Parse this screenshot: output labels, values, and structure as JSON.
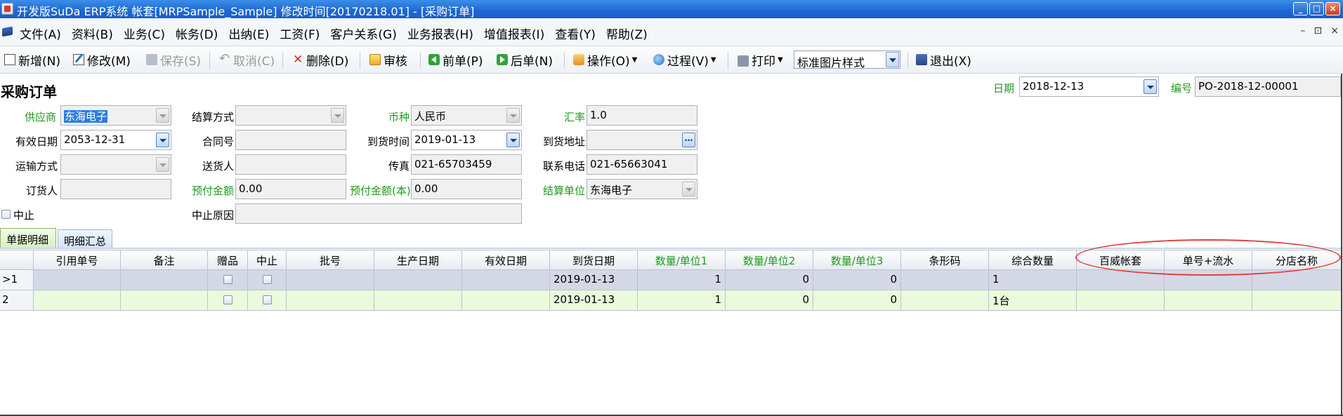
{
  "window": {
    "title": "开发版SuDa ERP系统  帐套[MRPSample_Sample] 修改时间[20170218.01] - [采购订单]",
    "controls": [
      "_",
      "□",
      "×"
    ]
  },
  "menu": {
    "items": [
      "文件(A)",
      "资料(B)",
      "业务(C)",
      "帐务(D)",
      "出纳(E)",
      "工资(F)",
      "客户关系(G)",
      "业务报表(H)",
      "增值报表(I)",
      "查看(Y)",
      "帮助(Z)"
    ],
    "mdi_controls": [
      "–",
      "⊡",
      "×"
    ]
  },
  "toolbar": {
    "new": "新增(N)",
    "edit": "修改(M)",
    "save": "保存(S)",
    "cancel": "取消(C)",
    "delete": "删除(D)",
    "audit": "审核",
    "prev": "前单(P)",
    "next": "后单(N)",
    "operation": "操作(O)",
    "process": "过程(V)",
    "print": "打印",
    "print_style": "标准图片样式",
    "exit": "退出(X)"
  },
  "form": {
    "title": "采购订单",
    "date_label": "日期",
    "date": "2018-12-13",
    "number_label": "编号",
    "number": "PO-2018-12-00001",
    "supplier_label": "供应商",
    "supplier": "东海电子",
    "settle_method_label": "结算方式",
    "settle_method": "",
    "currency_label": "币种",
    "currency": "人民币",
    "rate_label": "汇率",
    "rate": "1.0",
    "valid_date_label": "有效日期",
    "valid_date": "2053-12-31",
    "contract_label": "合同号",
    "contract": "",
    "arrival_time_label": "到货时间",
    "arrival_time": "2019-01-13",
    "arrival_addr_label": "到货地址",
    "arrival_addr": "",
    "transport_label": "运输方式",
    "transport": "",
    "deliverer_label": "送货人",
    "deliverer": "",
    "fax_label": "传真",
    "fax": "021-65703459",
    "phone_label": "联系电话",
    "phone": "021-65663041",
    "orderer_label": "订货人",
    "orderer": "",
    "prepay_label": "预付金额",
    "prepay": "0.00",
    "prepay_base_label": "预付金额(本)",
    "prepay_base": "0.00",
    "settle_unit_label": "结算单位",
    "settle_unit": "东海电子",
    "stop_label": "中止",
    "stop_reason_label": "中止原因",
    "stop_reason": ""
  },
  "tabs": [
    "单据明细",
    "明细汇总"
  ],
  "grid": {
    "columns": [
      "引用单号",
      "备注",
      "赠品",
      "中止",
      "批号",
      "生产日期",
      "有效日期",
      "到货日期",
      "数量/单位1",
      "数量/单位2",
      "数量/单位3",
      "条形码",
      "综合数量",
      "百威帐套",
      "单号+流水",
      "分店名称"
    ],
    "rows": [
      {
        "marker": ">1",
        "cells": [
          "",
          "",
          "",
          "",
          "",
          "",
          "",
          "2019-01-13",
          "1",
          "0",
          "0",
          "",
          "1",
          "",
          "",
          ""
        ]
      },
      {
        "marker": "2",
        "cells": [
          "",
          "",
          "",
          "",
          "",
          "",
          "",
          "2019-01-13",
          "1",
          "0",
          "0",
          "",
          "1台",
          "",
          "",
          ""
        ]
      }
    ]
  },
  "colors": {
    "titlebar": "#1d68d3",
    "green_label": "#1e9a1e",
    "row_selected": "#d5d8e6",
    "row_alt": "#eafadd",
    "annotation": "#e04040"
  }
}
